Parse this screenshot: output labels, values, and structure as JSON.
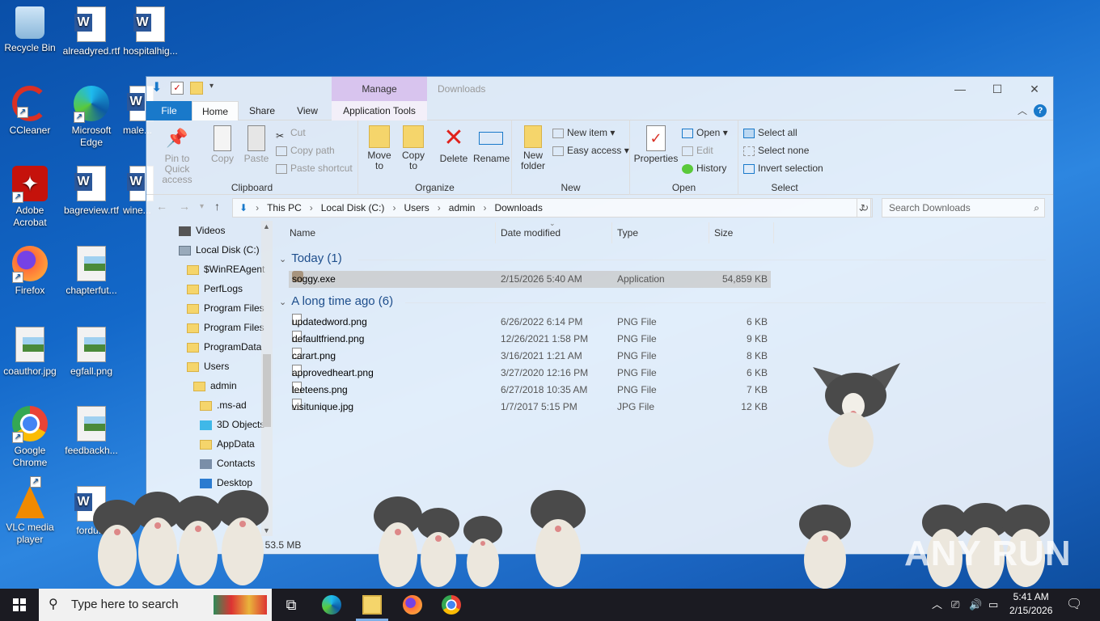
{
  "desktop": {
    "icons": [
      {
        "label": "Recycle Bin",
        "icon": "recycle-bin-icon"
      },
      {
        "label": "alreadyred.rtf",
        "icon": "word-document-icon"
      },
      {
        "label": "hospitalhig...",
        "icon": "word-document-icon"
      },
      {
        "label": "CCleaner",
        "icon": "ccleaner-icon"
      },
      {
        "label": "Microsoft Edge",
        "icon": "edge-icon"
      },
      {
        "label": "male...",
        "icon": "word-document-icon"
      },
      {
        "label": "Adobe Acrobat",
        "icon": "acrobat-icon"
      },
      {
        "label": "bagreview.rtf",
        "icon": "word-document-icon"
      },
      {
        "label": "wine...",
        "icon": "word-document-icon"
      },
      {
        "label": "Firefox",
        "icon": "firefox-icon"
      },
      {
        "label": "chapterfut...",
        "icon": "image-file-icon"
      },
      {
        "label": "coauthor.jpg",
        "icon": "image-file-icon"
      },
      {
        "label": "egfall.png",
        "icon": "image-file-icon"
      },
      {
        "label": "Google Chrome",
        "icon": "chrome-icon"
      },
      {
        "label": "feedbackh...",
        "icon": "image-file-icon"
      },
      {
        "label": "VLC media player",
        "icon": "vlc-icon"
      },
      {
        "label": "fordu...",
        "icon": "word-document-icon"
      }
    ]
  },
  "explorer": {
    "title": "Downloads",
    "manage_tab": "Manage",
    "tabs": {
      "file": "File",
      "home": "Home",
      "share": "Share",
      "view": "View",
      "app_tools": "Application Tools"
    },
    "ribbon": {
      "clipboard": {
        "pin": "Pin to Quick access",
        "copy": "Copy",
        "paste": "Paste",
        "cut": "Cut",
        "copy_path": "Copy path",
        "paste_shortcut": "Paste shortcut",
        "label": "Clipboard"
      },
      "organize": {
        "move_to": "Move to",
        "copy_to": "Copy to",
        "delete": "Delete",
        "rename": "Rename",
        "label": "Organize"
      },
      "new": {
        "new_folder": "New folder",
        "new_item": "New item",
        "easy_access": "Easy access",
        "label": "New"
      },
      "open": {
        "properties": "Properties",
        "open": "Open",
        "edit": "Edit",
        "history": "History",
        "label": "Open"
      },
      "select": {
        "select_all": "Select all",
        "select_none": "Select none",
        "invert": "Invert selection",
        "label": "Select"
      }
    },
    "address": {
      "parts": [
        "This PC",
        "Local Disk (C:)",
        "Users",
        "admin",
        "Downloads"
      ]
    },
    "search_placeholder": "Search Downloads",
    "nav": [
      {
        "label": "Videos"
      },
      {
        "label": "Local Disk (C:)"
      },
      {
        "label": "$WinREAgent"
      },
      {
        "label": "PerfLogs"
      },
      {
        "label": "Program Files"
      },
      {
        "label": "Program Files"
      },
      {
        "label": "ProgramData"
      },
      {
        "label": "Users"
      },
      {
        "label": "admin"
      },
      {
        "label": ".ms-ad"
      },
      {
        "label": "3D Objects"
      },
      {
        "label": "AppData"
      },
      {
        "label": "Contacts"
      },
      {
        "label": "Desktop"
      }
    ],
    "columns": {
      "name": "Name",
      "date": "Date modified",
      "type": "Type",
      "size": "Size"
    },
    "groups": [
      {
        "label": "Today (1)"
      },
      {
        "label": "A long time ago (6)"
      }
    ],
    "files": [
      {
        "name": "soggy.exe",
        "date": "2/15/2026 5:40 AM",
        "type": "Application",
        "size": "54,859 KB"
      },
      {
        "name": "updatedword.png",
        "date": "6/26/2022 6:14 PM",
        "type": "PNG File",
        "size": "6 KB"
      },
      {
        "name": "defaultfriend.png",
        "date": "12/26/2021 1:58 PM",
        "type": "PNG File",
        "size": "9 KB"
      },
      {
        "name": "carart.png",
        "date": "3/16/2021 1:21 AM",
        "type": "PNG File",
        "size": "8 KB"
      },
      {
        "name": "approvedheart.png",
        "date": "3/27/2020 12:16 PM",
        "type": "PNG File",
        "size": "6 KB"
      },
      {
        "name": "leeteens.png",
        "date": "6/27/2018 10:35 AM",
        "type": "PNG File",
        "size": "7 KB"
      },
      {
        "name": "visitunique.jpg",
        "date": "1/7/2017 5:15 PM",
        "type": "JPG File",
        "size": "12 KB"
      }
    ],
    "status": "ed  53.5 MB"
  },
  "taskbar": {
    "search_placeholder": "Type here to search",
    "time": "5:41 AM",
    "date": "2/15/2026"
  },
  "watermark": "ANY RUN"
}
